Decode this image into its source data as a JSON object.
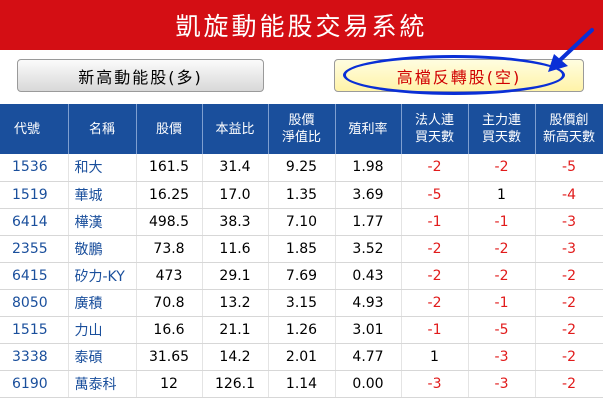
{
  "app": {
    "title": "凱旋動能股交易系統"
  },
  "buttons": {
    "left_label": "新高動能股(多)",
    "right_label": "高檔反轉股(空)"
  },
  "colors": {
    "title_bg": "#d40e14",
    "header_bg": "#1a4f9c",
    "negative": "#e11b1b",
    "highlight": "#0a2fd6"
  },
  "table": {
    "headers": [
      "代號",
      "名稱",
      "股價",
      "本益比",
      "股價\n淨值比",
      "殖利率",
      "法人連\n買天數",
      "主力連\n買天數",
      "股價創\n新高天數"
    ],
    "rows": [
      {
        "code": "1536",
        "name": "和大",
        "price": "161.5",
        "pe": "31.4",
        "pb": "9.25",
        "yield": "1.98",
        "inst": "-2",
        "main": "-2",
        "high": "-5"
      },
      {
        "code": "1519",
        "name": "華城",
        "price": "16.25",
        "pe": "17.0",
        "pb": "1.35",
        "yield": "3.69",
        "inst": "-5",
        "main": "1",
        "high": "-4"
      },
      {
        "code": "6414",
        "name": "樺漢",
        "price": "498.5",
        "pe": "38.3",
        "pb": "7.10",
        "yield": "1.77",
        "inst": "-1",
        "main": "-1",
        "high": "-3"
      },
      {
        "code": "2355",
        "name": "敬鵬",
        "price": "73.8",
        "pe": "11.6",
        "pb": "1.85",
        "yield": "3.52",
        "inst": "-2",
        "main": "-2",
        "high": "-3"
      },
      {
        "code": "6415",
        "name": "矽力-KY",
        "price": "473",
        "pe": "29.1",
        "pb": "7.69",
        "yield": "0.43",
        "inst": "-2",
        "main": "-2",
        "high": "-2"
      },
      {
        "code": "8050",
        "name": "廣積",
        "price": "70.8",
        "pe": "13.2",
        "pb": "3.15",
        "yield": "4.93",
        "inst": "-2",
        "main": "-1",
        "high": "-2"
      },
      {
        "code": "1515",
        "name": "力山",
        "price": "16.6",
        "pe": "21.1",
        "pb": "1.26",
        "yield": "3.01",
        "inst": "-1",
        "main": "-5",
        "high": "-2"
      },
      {
        "code": "3338",
        "name": "泰碩",
        "price": "31.65",
        "pe": "14.2",
        "pb": "2.01",
        "yield": "4.77",
        "inst": "1",
        "main": "-3",
        "high": "-2"
      },
      {
        "code": "6190",
        "name": "萬泰科",
        "price": "12",
        "pe": "126.1",
        "pb": "1.14",
        "yield": "0.00",
        "inst": "-3",
        "main": "-3",
        "high": "-2"
      }
    ]
  }
}
